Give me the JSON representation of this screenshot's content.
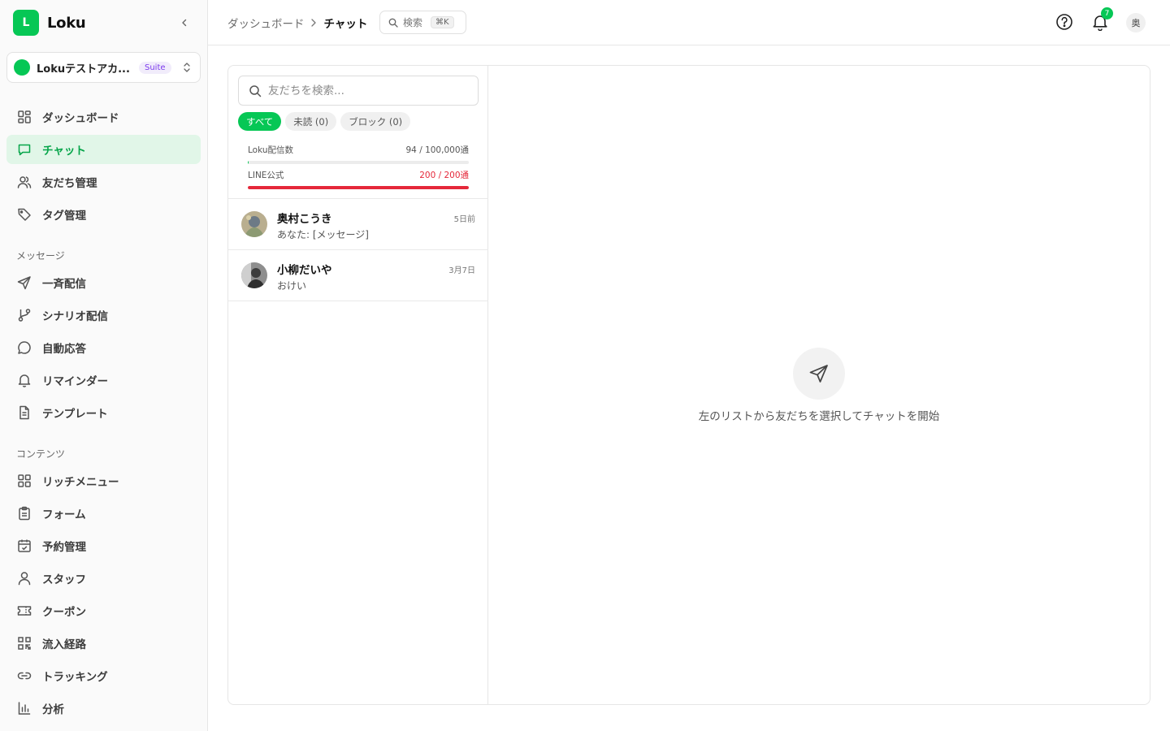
{
  "app": {
    "logo_letter": "L",
    "name": "Loku"
  },
  "account": {
    "name": "Lokuテストアカ...",
    "badge": "Suite"
  },
  "nav": {
    "main": [
      {
        "key": "dashboard",
        "label": "ダッシュボード",
        "icon": "grid-icon"
      },
      {
        "key": "chat",
        "label": "チャット",
        "icon": "chat-icon",
        "active": true
      },
      {
        "key": "friends",
        "label": "友だち管理",
        "icon": "users-icon"
      },
      {
        "key": "tags",
        "label": "タグ管理",
        "icon": "tag-icon"
      }
    ],
    "message_section": "メッセージ",
    "message": [
      {
        "key": "broadcast",
        "label": "一斉配信",
        "icon": "send-icon"
      },
      {
        "key": "scenario",
        "label": "シナリオ配信",
        "icon": "branch-icon"
      },
      {
        "key": "autoreply",
        "label": "自動応答",
        "icon": "message-circle-icon"
      },
      {
        "key": "reminder",
        "label": "リマインダー",
        "icon": "bell-icon"
      },
      {
        "key": "template",
        "label": "テンプレート",
        "icon": "file-icon"
      }
    ],
    "content_section": "コンテンツ",
    "content": [
      {
        "key": "richmenu",
        "label": "リッチメニュー",
        "icon": "grid-icon"
      },
      {
        "key": "form",
        "label": "フォーム",
        "icon": "clipboard-icon"
      },
      {
        "key": "booking",
        "label": "予約管理",
        "icon": "calendar-icon"
      },
      {
        "key": "staff",
        "label": "スタッフ",
        "icon": "user-icon"
      },
      {
        "key": "coupon",
        "label": "クーポン",
        "icon": "ticket-icon"
      },
      {
        "key": "source",
        "label": "流入経路",
        "icon": "qr-icon"
      },
      {
        "key": "tracking",
        "label": "トラッキング",
        "icon": "link-icon"
      },
      {
        "key": "analytics",
        "label": "分析",
        "icon": "bar-chart-icon"
      }
    ]
  },
  "topbar": {
    "breadcrumb_parent": "ダッシュボード",
    "breadcrumb_current": "チャット",
    "search_label": "検索",
    "search_shortcut": "⌘K",
    "notification_count": "7",
    "user_initial": "奥"
  },
  "chat_list": {
    "search_placeholder": "友だちを検索...",
    "filters": [
      {
        "label": "すべて",
        "active": true
      },
      {
        "label": "未読 (0)",
        "active": false
      },
      {
        "label": "ブロック (0)",
        "active": false
      }
    ],
    "quotas": [
      {
        "label": "Loku配信数",
        "value_text": "94 / 100,000通",
        "fraction": 0.00094,
        "status": "normal"
      },
      {
        "label": "LINE公式",
        "value_text": "200 / 200通",
        "fraction": 1.0,
        "status": "danger"
      }
    ],
    "chats": [
      {
        "name": "奥村こうき",
        "preview": "あなた: [メッセージ]",
        "time": "5日前"
      },
      {
        "name": "小柳だいや",
        "preview": "おけい",
        "time": "3月7日"
      }
    ]
  },
  "empty_state": {
    "text": "左のリストから友だちを選択してチャットを開始"
  },
  "colors": {
    "brand": "#06c755",
    "active_bg": "#e1f6e8",
    "danger": "#e5283a",
    "suite_purple": "#7c3aed"
  }
}
